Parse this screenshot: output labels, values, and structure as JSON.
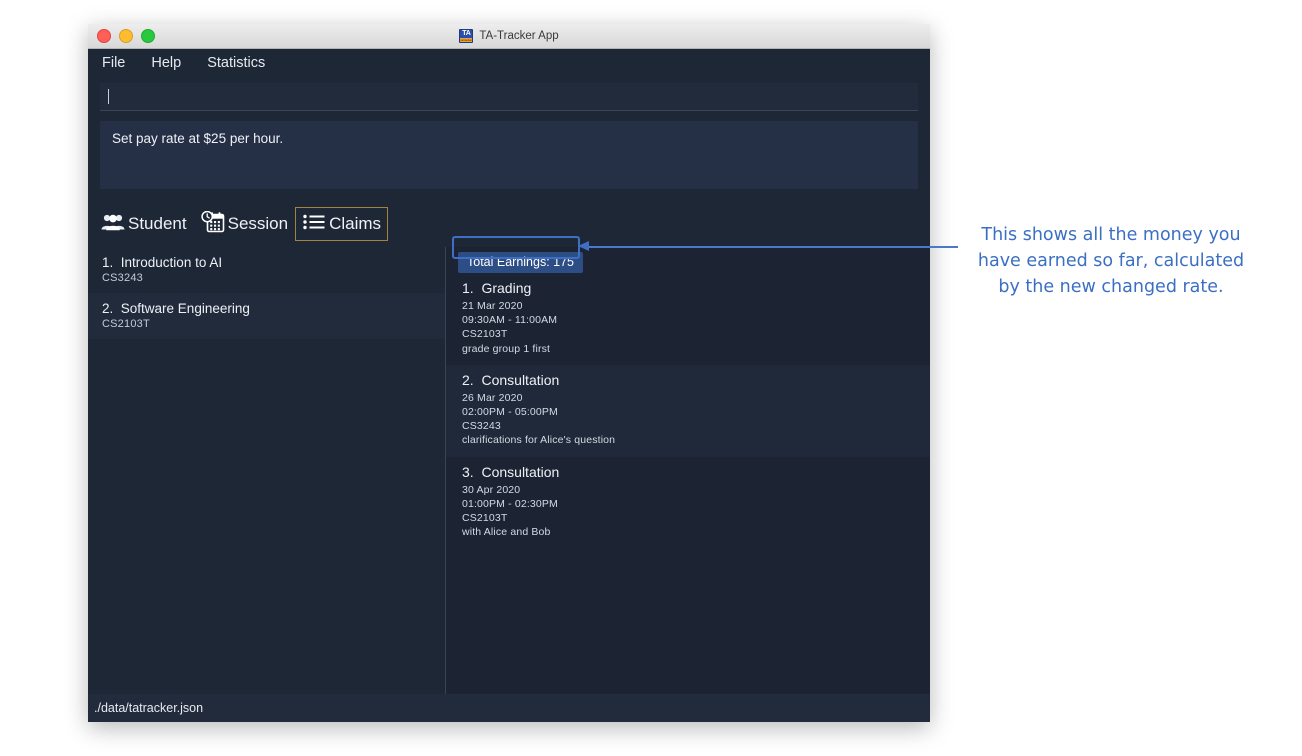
{
  "window": {
    "title": "TA-Tracker App",
    "app_icon_name": "ta-tracker-icon",
    "app_icon_text": "TA",
    "app_icon_subtext": "tatracker",
    "traffic_lights": [
      "close",
      "minimize",
      "zoom"
    ]
  },
  "menubar": {
    "items": [
      {
        "label": "File"
      },
      {
        "label": "Help"
      },
      {
        "label": "Statistics"
      }
    ]
  },
  "command_box": {
    "value": "",
    "placeholder": ""
  },
  "result_box": {
    "text": "Set pay rate at $25 per hour."
  },
  "tabs": [
    {
      "label": "Student",
      "icon": "people-icon",
      "selected": false
    },
    {
      "label": "Session",
      "icon": "calendar-clock-icon",
      "selected": false
    },
    {
      "label": "Claims",
      "icon": "list-icon",
      "selected": true
    }
  ],
  "modules": [
    {
      "index": "1.",
      "name": "Introduction to AI",
      "code": "CS3243"
    },
    {
      "index": "2.",
      "name": "Software Engineering",
      "code": "CS2103T"
    }
  ],
  "claims_panel": {
    "total_earnings_label": "Total Earnings: 175",
    "claims": [
      {
        "index": "1.",
        "type": "Grading",
        "date": "21 Mar 2020",
        "time": "09:30AM - 11:00AM",
        "module": "CS2103T",
        "description": "grade group 1 first"
      },
      {
        "index": "2.",
        "type": "Consultation",
        "date": "26 Mar 2020",
        "time": "02:00PM - 05:00PM",
        "module": "CS3243",
        "description": "clarifications for Alice's question"
      },
      {
        "index": "3.",
        "type": "Consultation",
        "date": "30 Apr 2020",
        "time": "01:00PM - 02:30PM",
        "module": "CS2103T",
        "description": "with Alice and Bob"
      }
    ]
  },
  "statusbar": {
    "path": "./data/tatracker.json"
  },
  "annotation": {
    "text": "This shows all the money you have earned so far, calculated by the new changed rate.",
    "color": "#3b6fc4",
    "highlight_color": "#3f6fc4"
  },
  "colors": {
    "window_bg": "#1e2736",
    "panel_bg": "#1c2433",
    "badge_bg": "#2d4d85",
    "tab_selected_border": "#a08441",
    "text": "#eef1f6"
  }
}
